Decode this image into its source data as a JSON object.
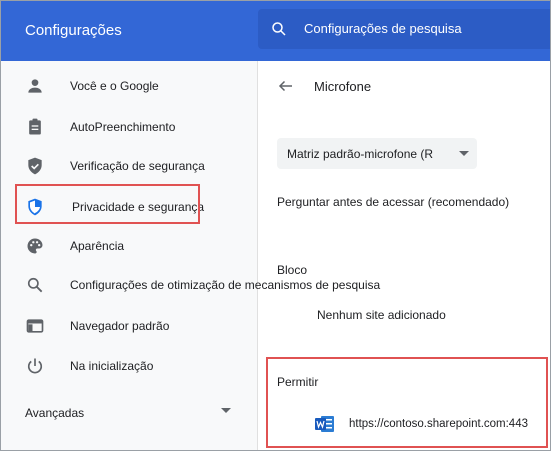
{
  "header": {
    "app_title": "Configurações",
    "search_placeholder": "Configurações de pesquisa"
  },
  "sidebar": {
    "items": [
      {
        "label": "Você e o Google",
        "icon": "person-icon"
      },
      {
        "label": "AutoPreenchimento",
        "icon": "clipboard-icon"
      },
      {
        "label": "Verificação de segurança",
        "icon": "shield-check-icon"
      },
      {
        "label": "Privacidade e segurança",
        "icon": "shield-privacy-icon",
        "selected": true
      },
      {
        "label": "Aparência",
        "icon": "palette-icon"
      },
      {
        "label": "Configurações de otimização de mecanismos de pesquisa",
        "icon": "search-icon"
      },
      {
        "label": "Navegador padrão",
        "icon": "browser-icon"
      },
      {
        "label": "Na inicialização",
        "icon": "power-icon"
      }
    ],
    "advanced_label": "Avançadas"
  },
  "main": {
    "title": "Microfone",
    "device_select_value": "Matriz padrão-microfone (R",
    "ask_label": "Perguntar antes de acessar (recomendado)",
    "block_heading": "Bloco",
    "block_empty": "Nenhum site adicionado",
    "allow_heading": "Permitir",
    "allow_sites": [
      {
        "url": "https://contoso.sharepoint.com:443",
        "icon": "word-icon"
      }
    ]
  },
  "colors": {
    "header_bg": "#3367d6",
    "search_bg": "#2c5cc5",
    "accent_blue": "#1a73e8",
    "highlight_red": "#e05252",
    "sidebar_bg": "#f8f9fa"
  }
}
